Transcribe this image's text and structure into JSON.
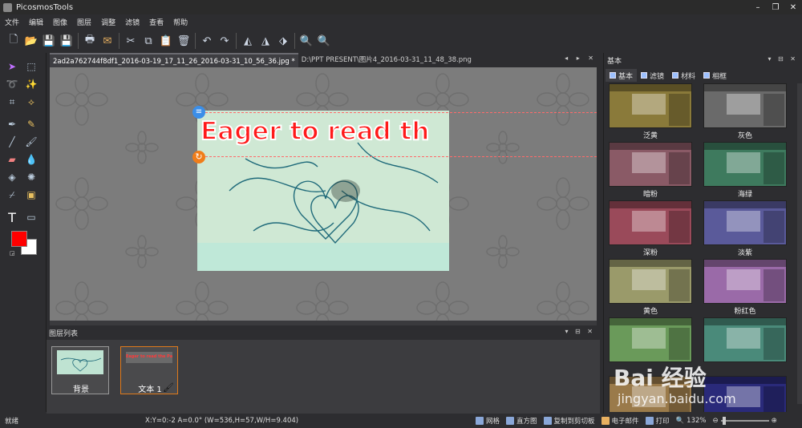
{
  "app": {
    "title": "PicosmosTools"
  },
  "window_buttons": [
    "–",
    "❐",
    "✕"
  ],
  "menu": [
    "文件",
    "编辑",
    "图像",
    "图层",
    "调整",
    "滤镜",
    "查看",
    "帮助"
  ],
  "tabs": [
    {
      "label": "2ad2a762744f8df1_2016-03-19_17_11_26_2016-03-31_10_56_36.jpg *",
      "active": true
    },
    {
      "label": "D:\\PPT PRESENT\\图片4_2016-03-31_11_48_38.png",
      "active": false
    }
  ],
  "tab_controls": "◂ ▸ ✕",
  "canvas": {
    "text_layer": "Eager to read th"
  },
  "layer_panel": {
    "title": "图层列表",
    "controls": "▾ ⊟ ✕",
    "layers": [
      {
        "label": "背景"
      },
      {
        "label": "文本 1"
      }
    ]
  },
  "right_panel": {
    "title": "基本",
    "controls": "▾ ⊟ ✕",
    "tabs": [
      "基本",
      "滤镜",
      "材料",
      "相框"
    ],
    "presets": [
      {
        "name": "泛黄",
        "color": "#8a7a3a"
      },
      {
        "name": "灰色",
        "color": "#6a6a6a"
      },
      {
        "name": "暗粉",
        "color": "#8a5a66"
      },
      {
        "name": "海绿",
        "color": "#3e7a5e"
      },
      {
        "name": "深粉",
        "color": "#9a4a5a"
      },
      {
        "name": "淡紫",
        "color": "#5a5a9a"
      },
      {
        "name": "黄色",
        "color": "#9a9a6a"
      },
      {
        "name": "粉红色",
        "color": "#9a6aa8"
      },
      {
        "name": "",
        "color": "#6a9a5a"
      },
      {
        "name": "",
        "color": "#4a8a7a"
      },
      {
        "name": "",
        "color": "#9a7a4a"
      },
      {
        "name": "",
        "color": "#2a2a7a"
      }
    ]
  },
  "status": {
    "left": "就绪",
    "coords": "X:Y=0:-2 A=0.0° (W=536,H=57,W/H=9.404)",
    "grid": "网格",
    "histogram": "直方图",
    "copy": "复制到剪切板",
    "email": "电子邮件",
    "print": "打印",
    "zoom": "132%"
  },
  "watermark": {
    "main": "Bai 经验",
    "sub": "jingyan.baidu.com"
  }
}
